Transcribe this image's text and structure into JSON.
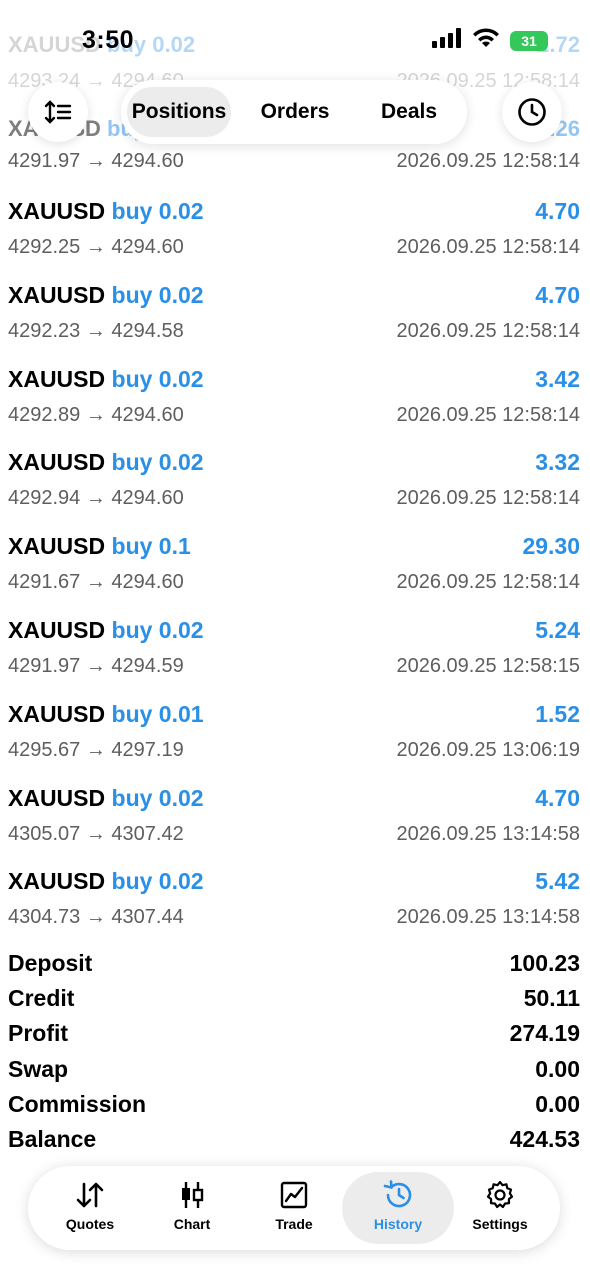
{
  "status_bar": {
    "time": "3:50",
    "battery": "31"
  },
  "ghost_rows": [
    {
      "symbol": "XAUUSD",
      "side": "buy 0.02",
      "profit": "2.72",
      "prices": "4293.24 → 4294.60",
      "date": "2026.09.25 12:58:14"
    },
    {
      "symbol": "XAUUSD",
      "side": "buy",
      "profit": "3.26",
      "prices": "",
      "date": ""
    }
  ],
  "segmented": {
    "tabs": [
      "Positions",
      "Orders",
      "Deals"
    ],
    "active": "Positions"
  },
  "deals": [
    {
      "symbol": "XAUUSD",
      "side": "buy 0.02",
      "profit": "",
      "prices": "4291.97 → 4294.60",
      "date": "2026.09.25 12:58:14"
    },
    {
      "symbol": "XAUUSD",
      "side": "buy 0.02",
      "profit": "4.70",
      "prices": "4292.25 → 4294.60",
      "date": "2026.09.25 12:58:14"
    },
    {
      "symbol": "XAUUSD",
      "side": "buy 0.02",
      "profit": "4.70",
      "prices": "4292.23 → 4294.58",
      "date": "2026.09.25 12:58:14"
    },
    {
      "symbol": "XAUUSD",
      "side": "buy 0.02",
      "profit": "3.42",
      "prices": "4292.89 → 4294.60",
      "date": "2026.09.25 12:58:14"
    },
    {
      "symbol": "XAUUSD",
      "side": "buy 0.02",
      "profit": "3.32",
      "prices": "4292.94 → 4294.60",
      "date": "2026.09.25 12:58:14"
    },
    {
      "symbol": "XAUUSD",
      "side": "buy 0.1",
      "profit": "29.30",
      "prices": "4291.67 → 4294.60",
      "date": "2026.09.25 12:58:14"
    },
    {
      "symbol": "XAUUSD",
      "side": "buy 0.02",
      "profit": "5.24",
      "prices": "4291.97 → 4294.59",
      "date": "2026.09.25 12:58:15"
    },
    {
      "symbol": "XAUUSD",
      "side": "buy 0.01",
      "profit": "1.52",
      "prices": "4295.67 → 4297.19",
      "date": "2026.09.25 13:06:19"
    },
    {
      "symbol": "XAUUSD",
      "side": "buy 0.02",
      "profit": "4.70",
      "prices": "4305.07 → 4307.42",
      "date": "2026.09.25 13:14:58"
    },
    {
      "symbol": "XAUUSD",
      "side": "buy 0.02",
      "profit": "5.42",
      "prices": "4304.73 → 4307.44",
      "date": "2026.09.25 13:14:58"
    }
  ],
  "summary": [
    {
      "label": "Deposit",
      "value": "100.23"
    },
    {
      "label": "Credit",
      "value": "50.11"
    },
    {
      "label": "Profit",
      "value": "274.19"
    },
    {
      "label": "Swap",
      "value": "0.00"
    },
    {
      "label": "Commission",
      "value": "0.00"
    },
    {
      "label": "Balance",
      "value": "424.53"
    }
  ],
  "tabbar": {
    "items": [
      {
        "label": "Quotes",
        "icon": "quotes-icon"
      },
      {
        "label": "Chart",
        "icon": "chart-icon"
      },
      {
        "label": "Trade",
        "icon": "trade-icon"
      },
      {
        "label": "History",
        "icon": "history-icon"
      },
      {
        "label": "Settings",
        "icon": "settings-icon"
      }
    ],
    "active": "History"
  },
  "colors": {
    "accent": "#2a8fe6",
    "muted": "#5e5e5e",
    "active_bg": "#ececec"
  }
}
